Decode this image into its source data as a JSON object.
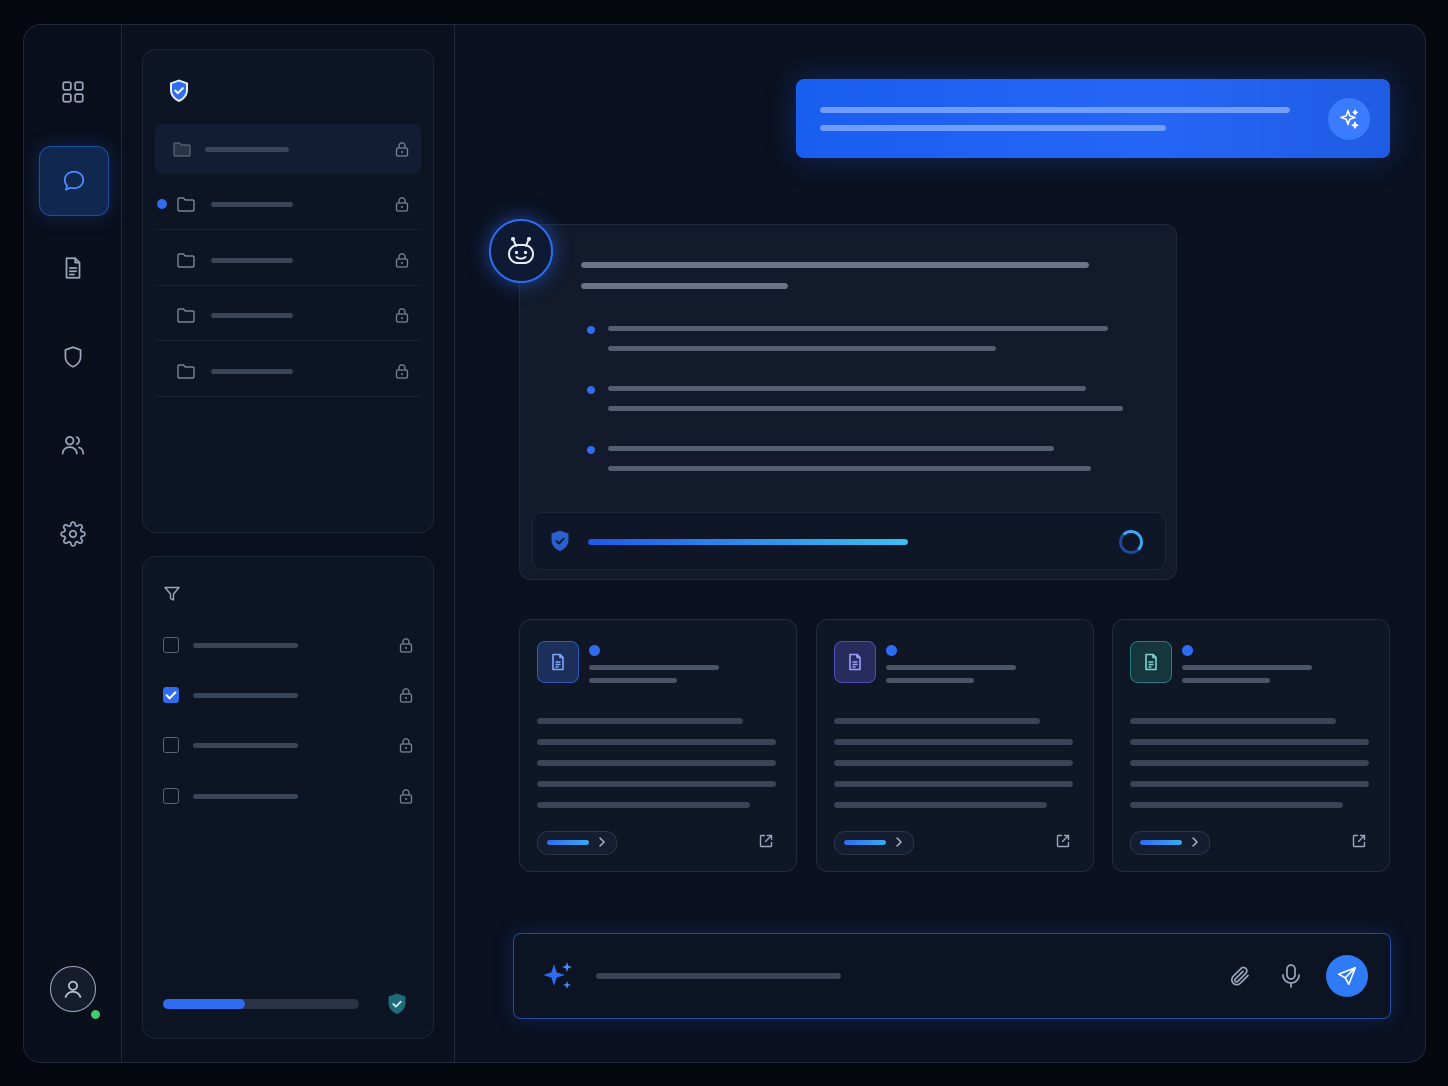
{
  "colors": {
    "accent": "#2f6cf0",
    "bubble": "#1a5ef0",
    "background": "#0b1120",
    "online": "#3fcf6a"
  },
  "nav": {
    "items": [
      {
        "icon": "grid-icon",
        "active": false
      },
      {
        "icon": "chat-bubble-icon",
        "active": true
      },
      {
        "icon": "document-icon",
        "active": false
      },
      {
        "icon": "shield-icon",
        "active": false
      },
      {
        "icon": "users-icon",
        "active": false
      },
      {
        "icon": "gear-icon",
        "active": false
      }
    ],
    "user_status": "online"
  },
  "sources": {
    "header_icon": "shield-check-icon",
    "folders": [
      {
        "icon": "folder-icon",
        "locked": true,
        "selected": true,
        "unread": false
      },
      {
        "icon": "folder-icon",
        "locked": true,
        "selected": false,
        "unread": true
      },
      {
        "icon": "folder-icon",
        "locked": true,
        "selected": false,
        "unread": false
      },
      {
        "icon": "folder-icon",
        "locked": true,
        "selected": false,
        "unread": false
      },
      {
        "icon": "folder-icon",
        "locked": true,
        "selected": false,
        "unread": false
      }
    ]
  },
  "filters": {
    "header_icon": "filter-icon",
    "options": [
      {
        "checked": false,
        "locked": true
      },
      {
        "checked": true,
        "locked": true
      },
      {
        "checked": false,
        "locked": true
      },
      {
        "checked": false,
        "locked": false
      }
    ],
    "progress": 0.42
  },
  "chat": {
    "assistant_avatar_icon": "robot-icon",
    "bullet_count": 3,
    "verification_progress": 0.55,
    "verification_status": "loading"
  },
  "documents": [
    {
      "icon": "file-text-icon",
      "tint": "#2f6cf0",
      "unread": true
    },
    {
      "icon": "file-text-icon",
      "tint": "#6a6ff0",
      "unread": true
    },
    {
      "icon": "file-text-icon",
      "tint": "#3aa7a8",
      "unread": true
    }
  ],
  "composer": {
    "spark_icon": "sparkles-icon",
    "attach_icon": "paperclip-icon",
    "mic_icon": "microphone-icon",
    "send_icon": "send-icon"
  }
}
